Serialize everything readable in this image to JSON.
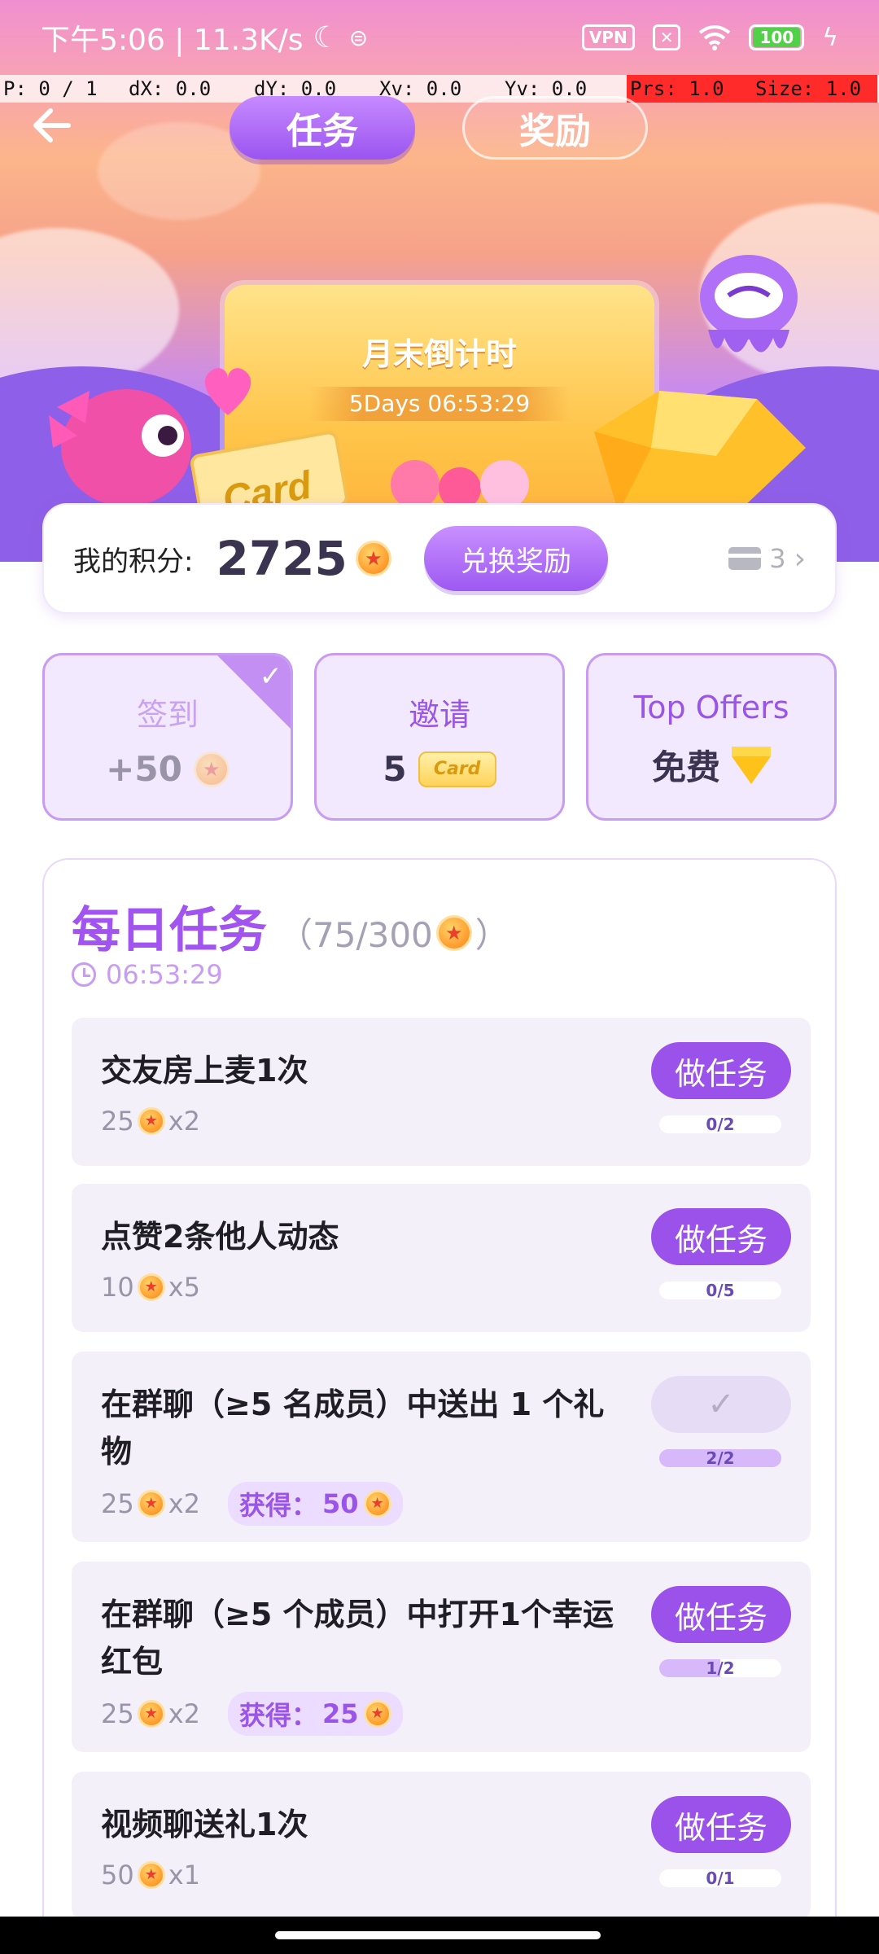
{
  "status_bar": {
    "time_speed": "下午5:06 | 11.3K/s",
    "vpn": "VPN",
    "battery": "100"
  },
  "debug_bar": [
    "P: 0 / 1",
    "dX: 0.0",
    "dY: 0.0",
    "Xv: 0.0",
    "Yv: 0.0",
    "Prs: 1.0",
    "Size: 1.0"
  ],
  "header": {
    "tabs": [
      {
        "label": "任务",
        "active": true
      },
      {
        "label": "奖励",
        "active": false
      }
    ]
  },
  "hero": {
    "title": "月末倒计时",
    "countdown": "5Days 06:53:29",
    "card_text": "Card"
  },
  "points": {
    "label": "我的积分:",
    "value": "2725",
    "exchange_label": "兑换奖励",
    "cards_count": "3"
  },
  "quick_cards": [
    {
      "title": "签到",
      "value": "+50",
      "done": true
    },
    {
      "title": "邀请",
      "value": "5",
      "badge": "Card"
    },
    {
      "title": "Top Offers",
      "value": "免费"
    }
  ],
  "daily": {
    "title": "每日任务",
    "progress_open": "（75/300",
    "progress_close": "）",
    "timer": "06:53:29",
    "tasks": [
      {
        "name": "交友房上麦1次",
        "reward": "25",
        "mult": "x2",
        "button": "做任务",
        "progress": "0/2",
        "progress_value": 0.0
      },
      {
        "name": "点赞2条他人动态",
        "reward": "10",
        "mult": "x5",
        "button": "做任务",
        "progress": "0/5",
        "progress_value": 0.0
      },
      {
        "name": "在群聊（≥5 名成员）中送出 1 个礼物",
        "reward": "25",
        "mult": "x2",
        "earned_label": "获得：",
        "earned_value": "50",
        "button": "✓",
        "progress": "2/2",
        "progress_value": 1.0
      },
      {
        "name": "在群聊（≥5 个成员）中打开1个幸运红包",
        "reward": "25",
        "mult": "x2",
        "earned_label": "获得：",
        "earned_value": "25",
        "button": "做任务",
        "progress": "1/2",
        "progress_value": 0.5
      },
      {
        "name": "视频聊送礼1次",
        "reward": "50",
        "mult": "x1",
        "button": "做任务",
        "progress": "0/1",
        "progress_value": 0.0
      }
    ]
  }
}
